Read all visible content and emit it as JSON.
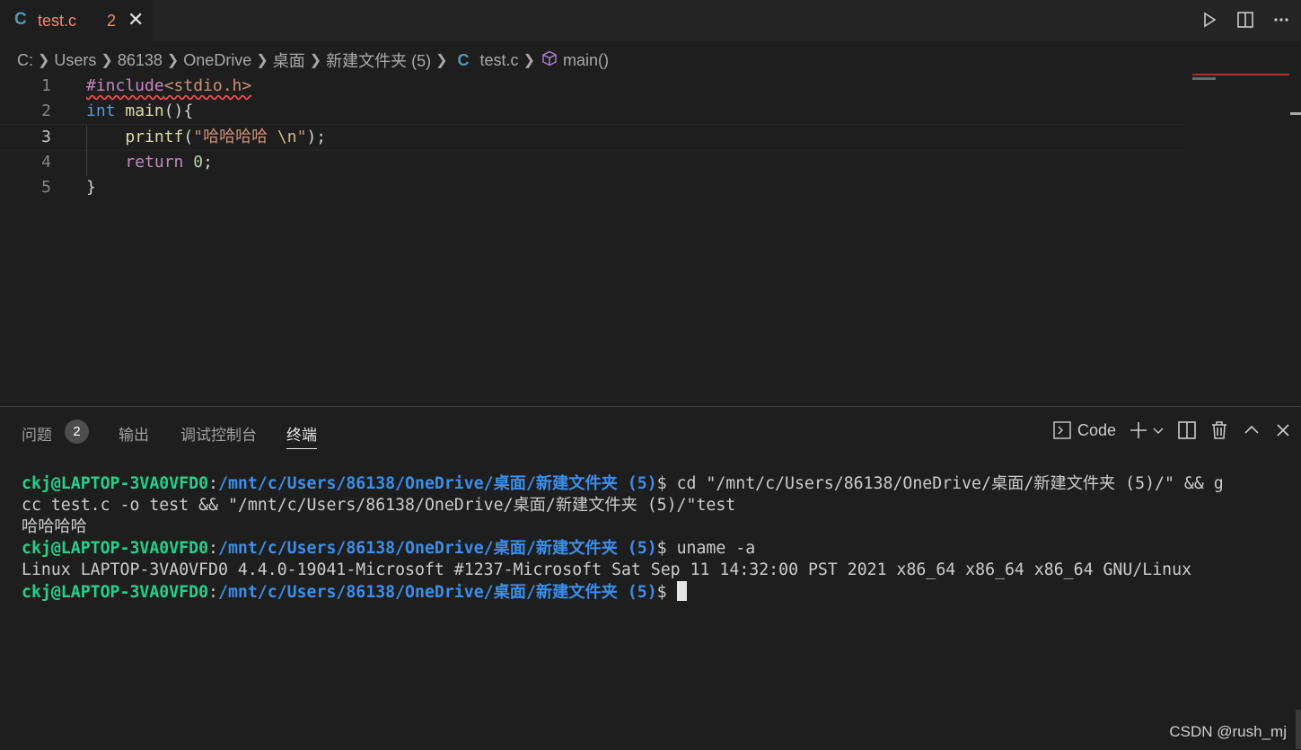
{
  "tab": {
    "icon": "C",
    "filename": "test.c",
    "problem_count": "2"
  },
  "breadcrumb": {
    "segments": [
      "C:",
      "Users",
      "86138",
      "OneDrive",
      "桌面",
      "新建文件夹 (5)"
    ],
    "file_icon": "C",
    "file": "test.c",
    "symbol": "main()"
  },
  "editor": {
    "line_numbers": [
      "1",
      "2",
      "3",
      "4",
      "5"
    ],
    "active_line": 3,
    "code": {
      "l1_directive": "#include",
      "l1_header": "<stdio.h>",
      "l2_type": "int",
      "l2_fn": "main",
      "l2_rest": "(){",
      "l3_fn": "printf",
      "l3_open": "(",
      "l3_str": "\"哈哈哈哈 ",
      "l3_esc": "\\n",
      "l3_strend": "\"",
      "l3_close": ");",
      "l4_kw": "return",
      "l4_num": "0",
      "l4_semi": ";",
      "l5": "}"
    }
  },
  "panel": {
    "tabs": [
      "问题",
      "输出",
      "调试控制台",
      "终端"
    ],
    "problems_badge": "2",
    "terminal_profile": "Code"
  },
  "terminal": {
    "user": "ckj@LAPTOP-3VA0VFD0",
    "colon": ":",
    "path": "/mnt/c/Users/86138/OneDrive/桌面/新建文件夹 (5)",
    "dollar": "$ ",
    "cmd1": "cd \"/mnt/c/Users/86138/OneDrive/桌面/新建文件夹 (5)/\" && g",
    "cmd1_wrap": "cc test.c -o test && \"/mnt/c/Users/86138/OneDrive/桌面/新建文件夹 (5)/\"test",
    "out1": "哈哈哈哈",
    "cmd2": "uname -a",
    "out2": "Linux LAPTOP-3VA0VFD0 4.4.0-19041-Microsoft #1237-Microsoft Sat Sep 11 14:32:00 PST 2021 x86_64 x86_64 x86_64 GNU/Linux"
  },
  "watermark": "CSDN @rush_mj",
  "icons": [
    "c-file-icon",
    "close-icon",
    "run-icon",
    "split-editor-icon",
    "more-icon",
    "chevron-right-icon",
    "cube-symbol-icon",
    "terminal-icon",
    "plus-icon",
    "chevron-down-icon",
    "split-terminal-icon",
    "trash-icon",
    "chevron-up-icon",
    "panel-close-icon"
  ]
}
